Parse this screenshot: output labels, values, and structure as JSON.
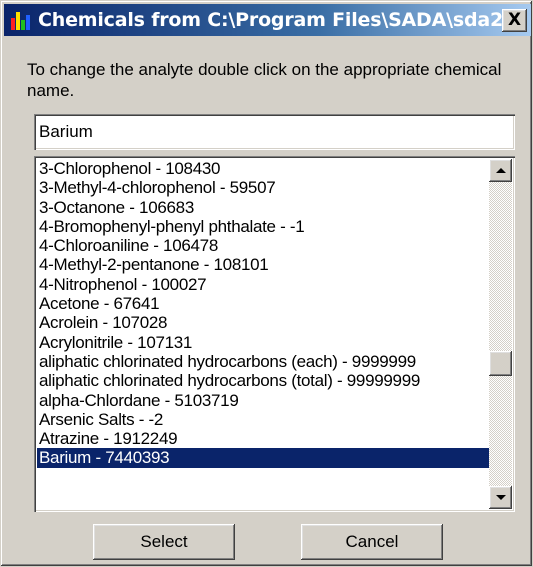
{
  "window": {
    "title": "Chemicals from C:\\Program Files\\SADA\\sda2...",
    "close_label": "X"
  },
  "instructions": "To change the analyte double click on the appropriate chemical name.",
  "analyte_field": {
    "value": "Barium"
  },
  "chemical_list": [
    "3-Chlorophenol  -  108430",
    "3-Methyl-4-chlorophenol  -  59507",
    "3-Octanone  -  106683",
    "4-Bromophenyl-phenyl phthalate  -  -1",
    "4-Chloroaniline  -  106478",
    "4-Methyl-2-pentanone  -  108101",
    "4-Nitrophenol  -  100027",
    "Acetone  -  67641",
    "Acrolein  -  107028",
    "Acrylonitrile  -  107131",
    "aliphatic chlorinated hydrocarbons (each)  -  9999999",
    "aliphatic chlorinated hydrocarbons (total)  -  99999999",
    "alpha-Chlordane  -  5103719",
    "Arsenic Salts  -  -2",
    "Atrazine  -  1912249",
    "Barium  -  7440393"
  ],
  "selected_index": 15,
  "buttons": {
    "select": "Select",
    "cancel": "Cancel"
  },
  "colors": {
    "title_gradient_start": "#0a246a",
    "title_gradient_end": "#a6caf0",
    "selection": "#0a246a",
    "face": "#d4d0c8"
  }
}
